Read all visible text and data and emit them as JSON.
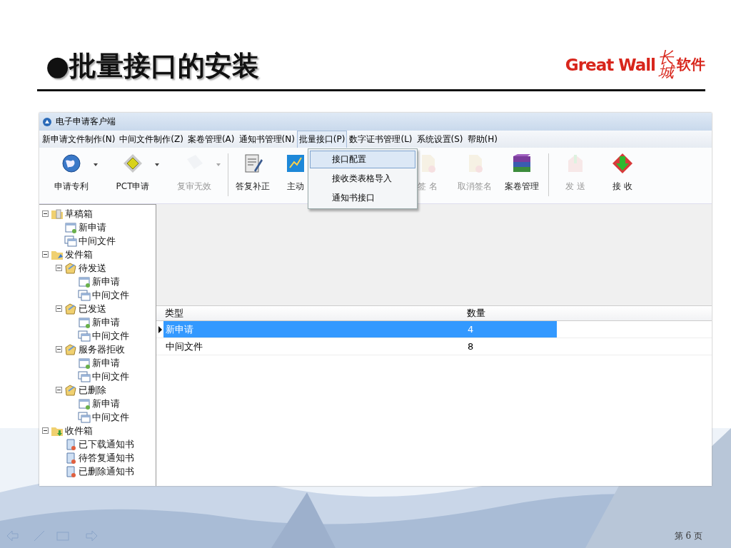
{
  "slide": {
    "title": "●批量接口的安装",
    "logo": {
      "wordmark": "Great Wall",
      "mark": "长城",
      "suffix": "软件"
    },
    "page_number": "第 6 页"
  },
  "window": {
    "title": "电子申请客户端",
    "menu": [
      {
        "label": "新申请文件制作(N)",
        "selected": false
      },
      {
        "label": "中间文件制作(Z)",
        "selected": false
      },
      {
        "label": "案卷管理(A)",
        "selected": false
      },
      {
        "label": "通知书管理(N)",
        "selected": false
      },
      {
        "label": "批量接口(P)",
        "selected": true
      },
      {
        "label": "数字证书管理(L)",
        "selected": false
      },
      {
        "label": "系统设置(S)",
        "selected": false
      },
      {
        "label": "帮助(H)",
        "selected": false
      }
    ],
    "dropdown": [
      {
        "label": "接口配置",
        "selected": true
      },
      {
        "label": "接收类表格导入",
        "selected": false
      },
      {
        "label": "通知书接口",
        "selected": false
      }
    ],
    "toolbar": [
      {
        "label": "申请专利",
        "kind": "globe",
        "disabled": false,
        "dropdown": true,
        "separator": false
      },
      {
        "label": "PCT申请",
        "kind": "diamond",
        "disabled": false,
        "dropdown": true,
        "separator": false
      },
      {
        "label": "复审无效",
        "kind": "page",
        "disabled": true,
        "dropdown": true,
        "separator": false
      },
      {
        "label": "答复补正",
        "kind": "notepad",
        "disabled": false,
        "dropdown": false,
        "separator": true
      },
      {
        "label": "主动",
        "kind": "board",
        "disabled": false,
        "dropdown": false,
        "separator": false
      },
      {
        "label": "签 名",
        "kind": "seal",
        "disabled": true,
        "dropdown": false,
        "separator": false
      },
      {
        "label": "取消签名",
        "kind": "seal",
        "disabled": true,
        "dropdown": false,
        "separator": false
      },
      {
        "label": "案卷管理",
        "kind": "books",
        "disabled": false,
        "dropdown": false,
        "separator": false
      },
      {
        "label": "发 送",
        "kind": "send",
        "disabled": true,
        "dropdown": false,
        "separator": true
      },
      {
        "label": "接 收",
        "kind": "receive",
        "disabled": false,
        "dropdown": false,
        "separator": false
      }
    ],
    "tree": [
      {
        "label": "草稿箱",
        "kind": "drafts",
        "expanded": true,
        "children": [
          {
            "label": "新申请",
            "kind": "new"
          },
          {
            "label": "中间文件",
            "kind": "mid"
          }
        ]
      },
      {
        "label": "发件箱",
        "kind": "outbox",
        "expanded": true,
        "children": [
          {
            "label": "待发送",
            "kind": "state",
            "expanded": true,
            "children": [
              {
                "label": "新申请",
                "kind": "new"
              },
              {
                "label": "中间文件",
                "kind": "mid"
              }
            ]
          },
          {
            "label": "已发送",
            "kind": "state",
            "expanded": true,
            "children": [
              {
                "label": "新申请",
                "kind": "new"
              },
              {
                "label": "中间文件",
                "kind": "mid"
              }
            ]
          },
          {
            "label": "服务器拒收",
            "kind": "state",
            "expanded": true,
            "children": [
              {
                "label": "新申请",
                "kind": "new"
              },
              {
                "label": "中间文件",
                "kind": "mid"
              }
            ]
          },
          {
            "label": "已删除",
            "kind": "state",
            "expanded": true,
            "children": [
              {
                "label": "新申请",
                "kind": "new"
              },
              {
                "label": "中间文件",
                "kind": "mid"
              }
            ]
          }
        ]
      },
      {
        "label": "收件箱",
        "kind": "inbox",
        "expanded": true,
        "children": [
          {
            "label": "已下载通知书",
            "kind": "notice"
          },
          {
            "label": "待答复通知书",
            "kind": "notice"
          },
          {
            "label": "已删除通知书",
            "kind": "notice"
          }
        ]
      }
    ],
    "table": {
      "columns": [
        "类型",
        "数量"
      ],
      "rows": [
        {
          "cells": [
            "新申请",
            "4"
          ],
          "selected": true
        },
        {
          "cells": [
            "中间文件",
            "8"
          ],
          "selected": false
        }
      ]
    }
  }
}
